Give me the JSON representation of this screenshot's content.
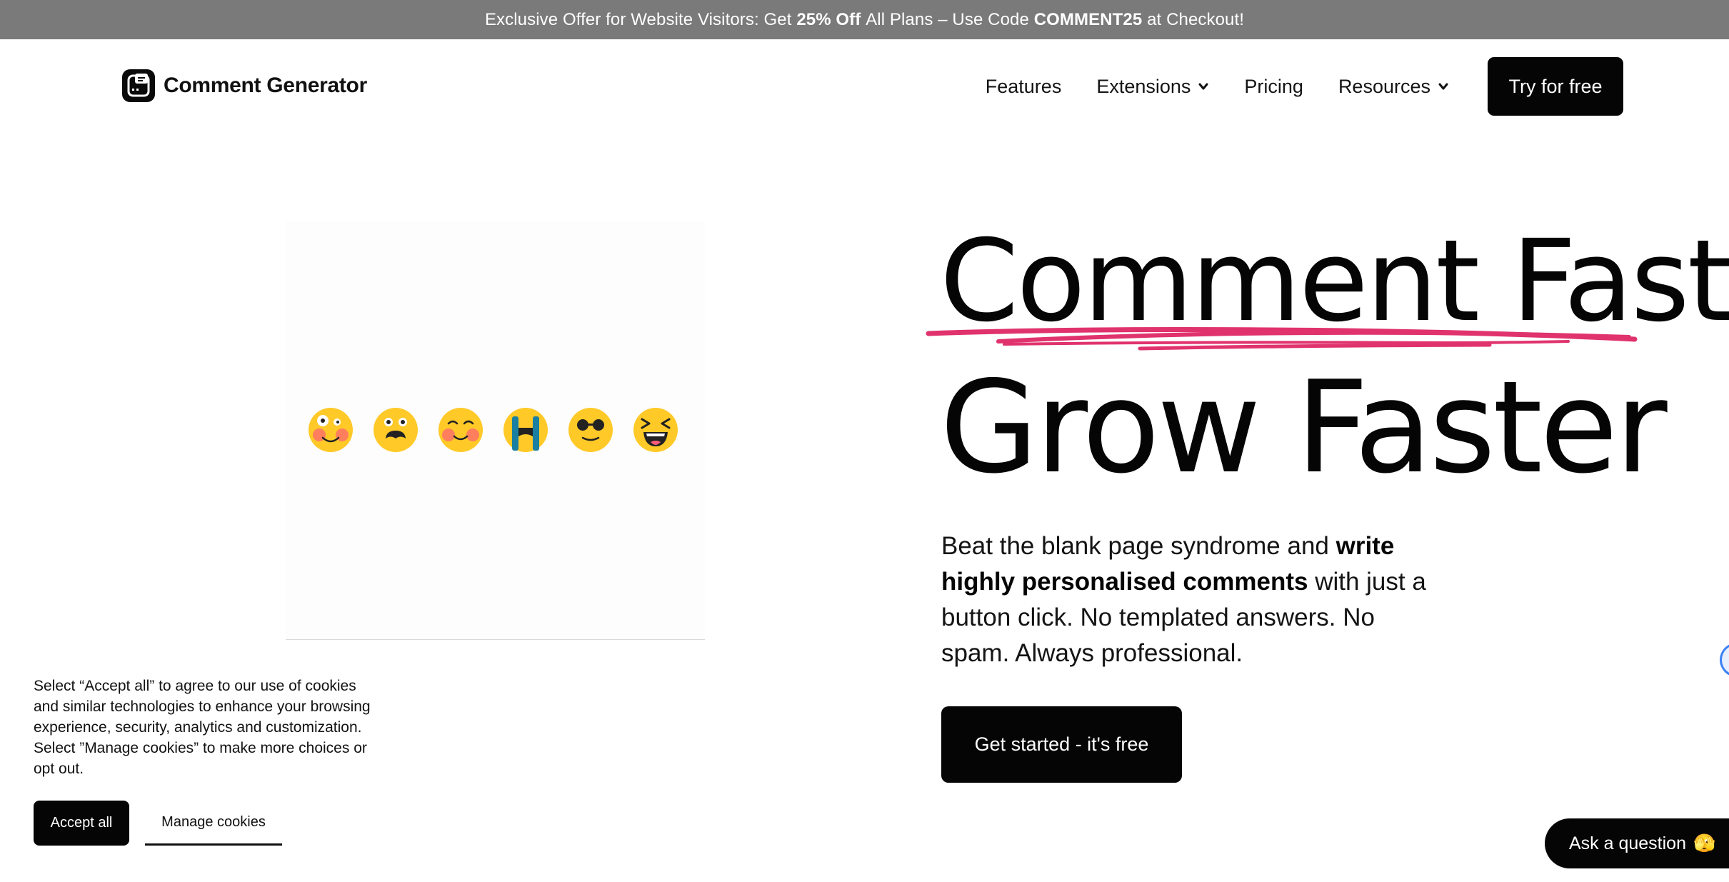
{
  "promo": {
    "prefix": "Exclusive Offer for Website Visitors: Get ",
    "discount": "25% Off",
    "middle": " All Plans – Use Code ",
    "code": "COMMENT25",
    "suffix": " at Checkout!"
  },
  "brand": {
    "name": "Comment Generator"
  },
  "nav": {
    "items": [
      {
        "label": "Features",
        "has_dropdown": false
      },
      {
        "label": "Extensions",
        "has_dropdown": true
      },
      {
        "label": "Pricing",
        "has_dropdown": false
      },
      {
        "label": "Resources",
        "has_dropdown": true
      }
    ],
    "cta": "Try for free"
  },
  "hero": {
    "line1": "Comment Fast",
    "line2": "Grow Faster",
    "desc_part1": "Beat the blank page syndrome and ",
    "desc_bold": "write highly personalised comments",
    "desc_part2": " with just a button click. No templated answers. No spam. Always professional.",
    "cta": "Get started - it's free",
    "accent_color": "#e0336e",
    "emojis": [
      "goofy-face-icon",
      "shocked-face-icon",
      "blushing-face-icon",
      "crying-face-icon",
      "sunglasses-face-icon",
      "laughing-face-icon"
    ]
  },
  "cookie": {
    "text": "Select “Accept all” to agree to our use of cookies and similar technologies to enhance your browsing experience, security, analytics and customization. Select ”Manage cookies” to make more choices or opt out.",
    "accept": "Accept all",
    "manage": "Manage cookies"
  },
  "chat": {
    "label": "Ask a question",
    "emoji": "🫣"
  }
}
